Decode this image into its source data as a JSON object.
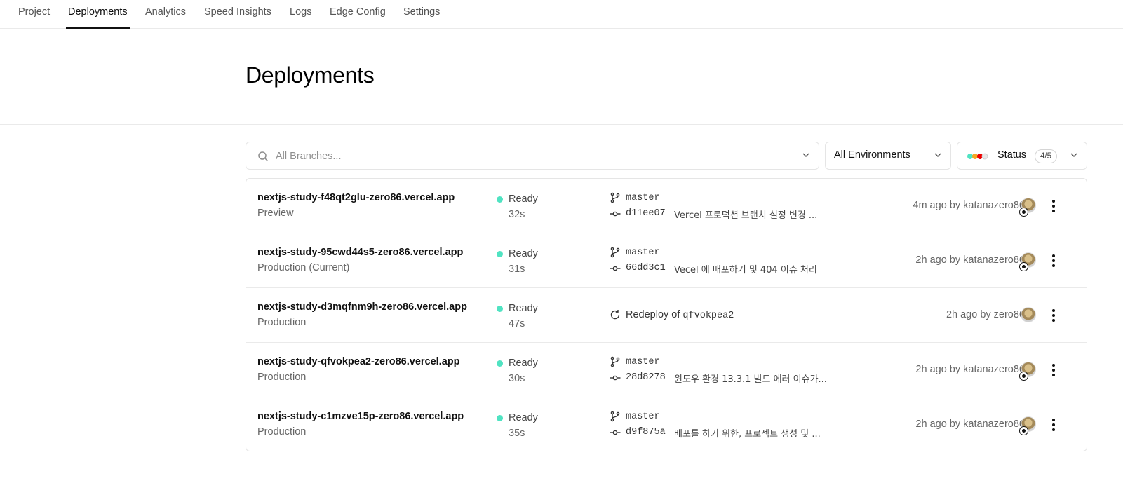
{
  "nav": {
    "tabs": [
      {
        "label": "Project"
      },
      {
        "label": "Deployments"
      },
      {
        "label": "Analytics"
      },
      {
        "label": "Speed Insights"
      },
      {
        "label": "Logs"
      },
      {
        "label": "Edge Config"
      },
      {
        "label": "Settings"
      }
    ],
    "active": "Deployments"
  },
  "page": {
    "title": "Deployments"
  },
  "filters": {
    "search_placeholder": "All Branches...",
    "environment": "All Environments",
    "status_label": "Status",
    "status_count": "4/5",
    "status_dot_colors": [
      "#50e3c2",
      "#f5a623",
      "#e00",
      "#ddd"
    ]
  },
  "deployments": [
    {
      "url": "nextjs-study-f48qt2glu-zero86.vercel.app",
      "environment": "Preview",
      "status": "Ready",
      "duration": "32s",
      "branch": "master",
      "commit_hash": "d11ee07",
      "commit_message": "Vercel 프로덕션 브랜치 설정 변경 ...",
      "meta": "4m ago by katanazero86"
    },
    {
      "url": "nextjs-study-95cwd44s5-zero86.vercel.app",
      "environment": "Production (Current)",
      "status": "Ready",
      "duration": "31s",
      "branch": "master",
      "commit_hash": "66dd3c1",
      "commit_message": "Vecel 에 배포하기 및 404 이슈 처리",
      "meta": "2h ago by katanazero86"
    },
    {
      "url": "nextjs-study-d3mqfnm9h-zero86.vercel.app",
      "environment": "Production",
      "status": "Ready",
      "duration": "47s",
      "redeploy_prefix": "Redeploy of",
      "redeploy_of": "qfvokpea2",
      "meta": "2h ago by zero86"
    },
    {
      "url": "nextjs-study-qfvokpea2-zero86.vercel.app",
      "environment": "Production",
      "status": "Ready",
      "duration": "30s",
      "branch": "master",
      "commit_hash": "28d8278",
      "commit_message": "윈도우 환경 13.3.1 빌드 에러 이슈가...",
      "meta": "2h ago by katanazero86"
    },
    {
      "url": "nextjs-study-c1mzve15p-zero86.vercel.app",
      "environment": "Production",
      "status": "Ready",
      "duration": "35s",
      "branch": "master",
      "commit_hash": "d9f875a",
      "commit_message": "배포를 하기 위한, 프로젝트 생성 및 ...",
      "meta": "2h ago by katanazero86"
    }
  ],
  "icons": {
    "search": "search-icon",
    "chevron": "chevron-down-icon",
    "branch": "git-branch-icon",
    "commit": "git-commit-icon",
    "redeploy": "refresh-icon",
    "more": "more-vertical-icon",
    "github": "github-icon"
  },
  "colors": {
    "ready": "#50e3c2",
    "active_tab_underline": "#111111"
  }
}
